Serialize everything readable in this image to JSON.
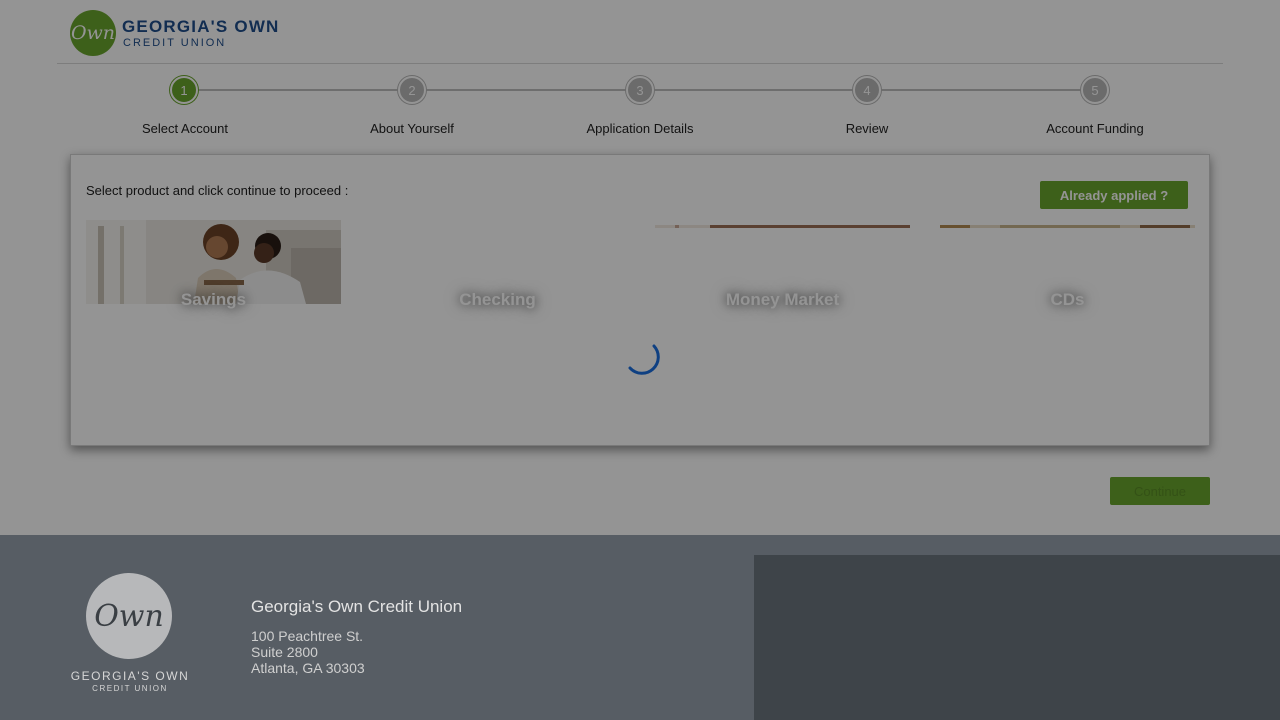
{
  "header": {
    "logo_mark": "Own",
    "logo_title": "GEORGIA'S OWN",
    "logo_sub": "CREDIT UNION"
  },
  "stepper": {
    "steps": [
      {
        "number": "1",
        "label": "Select Account",
        "active": true
      },
      {
        "number": "2",
        "label": "About Yourself",
        "active": false
      },
      {
        "number": "3",
        "label": "Application Details",
        "active": false
      },
      {
        "number": "4",
        "label": "Review",
        "active": false
      },
      {
        "number": "5",
        "label": "Account Funding",
        "active": false
      }
    ]
  },
  "panel": {
    "instruction": "Select product and click continue to proceed :",
    "already_applied_label": "Already applied ?",
    "products": [
      {
        "label": "Savings"
      },
      {
        "label": "Checking"
      },
      {
        "label": "Money Market"
      },
      {
        "label": "CDs"
      }
    ]
  },
  "continue_label": "Continue",
  "footer": {
    "logo_mark": "Own",
    "logo_title": "GEORGIA'S OWN",
    "logo_sub": "CREDIT UNION",
    "org_name": "Georgia's Own Credit Union",
    "address_line1": "100 Peachtree St.",
    "address_line2": "Suite 2800",
    "address_line3": "Atlanta, GA 30303"
  },
  "colors": {
    "brand_green": "#6aa52d",
    "brand_blue": "#1f4e8c",
    "spinner_blue": "#1a6fe0",
    "footer_bg": "#575d64"
  }
}
